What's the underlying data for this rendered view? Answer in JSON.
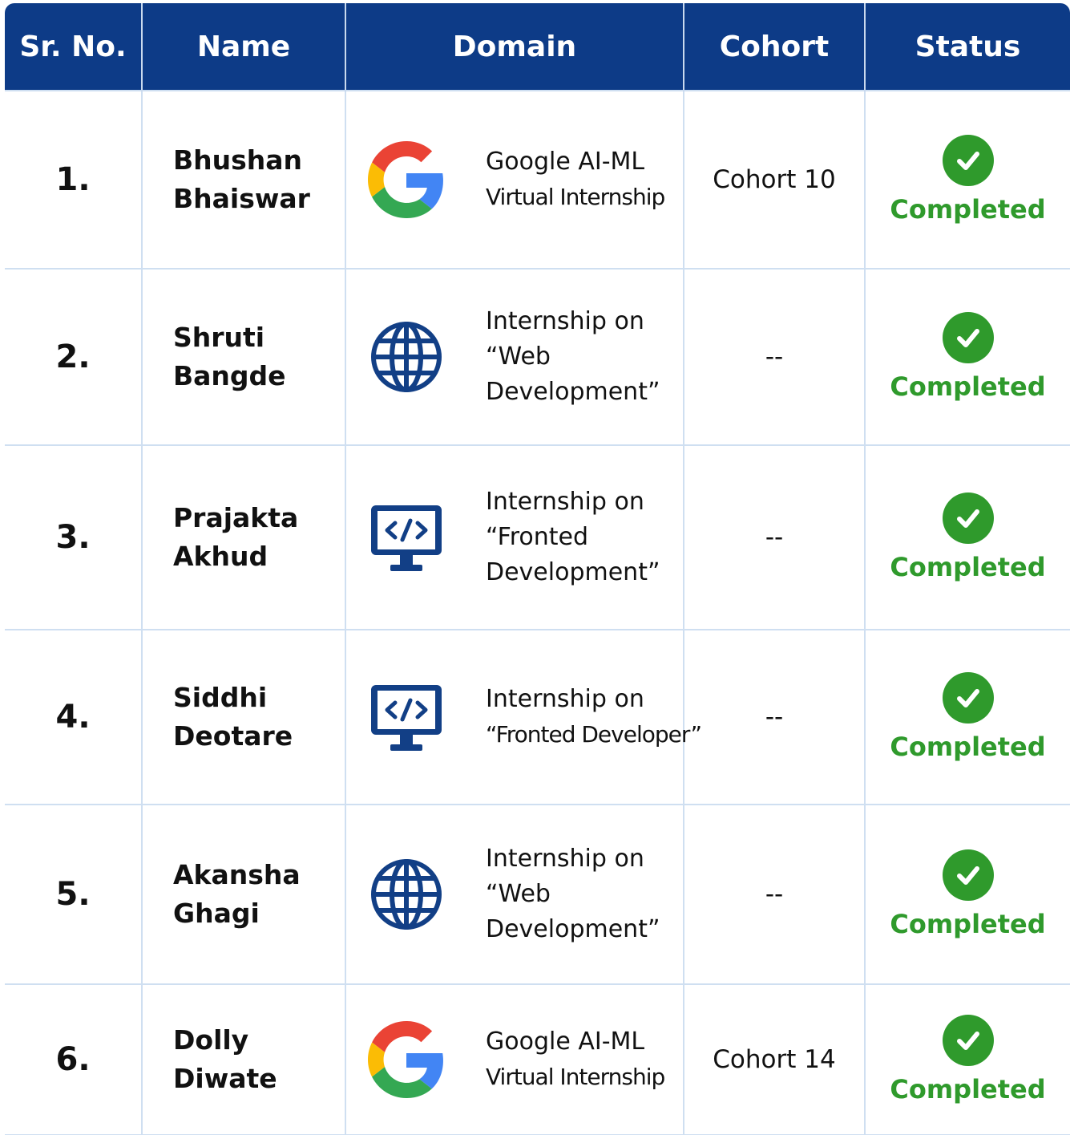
{
  "headers": [
    "Sr. No.",
    "Name",
    "Domain",
    "Cohort",
    "Status"
  ],
  "rows": [
    {
      "sr": "1.",
      "name": [
        "Bhushan",
        "Bhaiswar"
      ],
      "domain_icon": "google-icon",
      "domain_lines": [
        "Google AI-ML",
        "Virtual Internship"
      ],
      "cohort": "Cohort 10",
      "status": "Completed"
    },
    {
      "sr": "2.",
      "name": [
        "Shruti",
        "Bangde"
      ],
      "domain_icon": "globe-icon",
      "domain_lines": [
        "Internship on",
        "“Web",
        "Development”"
      ],
      "cohort": "--",
      "status": "Completed"
    },
    {
      "sr": "3.",
      "name": [
        "Prajakta",
        "Akhud"
      ],
      "domain_icon": "code-monitor-icon",
      "domain_lines": [
        "Internship on",
        "“Fronted",
        "Development”"
      ],
      "cohort": "--",
      "status": "Completed"
    },
    {
      "sr": "4.",
      "name": [
        "Siddhi",
        "Deotare"
      ],
      "domain_icon": "code-monitor-icon",
      "domain_lines": [
        "Internship on",
        "“Fronted Developer”"
      ],
      "cohort": "--",
      "status": "Completed"
    },
    {
      "sr": "5.",
      "name": [
        "Akansha",
        "Ghagi"
      ],
      "domain_icon": "globe-icon",
      "domain_lines": [
        "Internship on",
        "“Web",
        "Development”"
      ],
      "cohort": "--",
      "status": "Completed"
    },
    {
      "sr": "6.",
      "name": [
        "Dolly",
        "Diwate"
      ],
      "domain_icon": "google-icon",
      "domain_lines": [
        "Google AI-ML",
        "Virtual Internship"
      ],
      "cohort": "Cohort 14",
      "status": "Completed"
    }
  ],
  "colors": {
    "header_bg": "#0d3b87",
    "status_green": "#2f9a2c",
    "icon_blue": "#123f86"
  }
}
